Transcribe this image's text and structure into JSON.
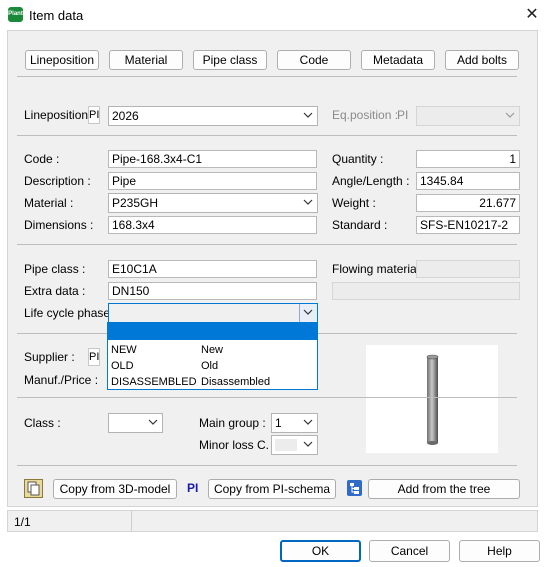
{
  "window": {
    "title": "Item data",
    "app_icon_text": "Plant"
  },
  "tabs": [
    "Lineposition",
    "Material",
    "Pipe class",
    "Code",
    "Metadata",
    "Add bolts"
  ],
  "lineposition": {
    "label": "Lineposition :",
    "pi": "PI",
    "value": "2026",
    "eq_label": "Eq.position :",
    "eq_pi": "PI",
    "eq_value": ""
  },
  "left_fields": {
    "code_label": "Code :",
    "code": "Pipe-168.3x4-C1",
    "description_label": "Description :",
    "description": "Pipe",
    "material_label": "Material :",
    "material": "P235GH",
    "dimensions_label": "Dimensions :",
    "dimensions": "168.3x4"
  },
  "right_fields": {
    "quantity_label": "Quantity :",
    "quantity": "1",
    "angle_label": "Angle/Length :",
    "angle": "1345.84",
    "weight_label": "Weight :",
    "weight": "21.677",
    "standard_label": "Standard :",
    "standard": "SFS-EN10217-2"
  },
  "pipe": {
    "pipe_class_label": "Pipe class :",
    "pipe_class": "E10C1A",
    "extra_label": "Extra data :",
    "extra": "DN150",
    "lifecycle_label": "Life cycle phase:",
    "lifecycle": "",
    "flowing_label": "Flowing material :",
    "flowing": ""
  },
  "lifecycle_options": [
    {
      "code": "NEW",
      "name": "New"
    },
    {
      "code": "OLD",
      "name": "Old"
    },
    {
      "code": "DISASSEMBLED",
      "name": "Disassembled"
    }
  ],
  "supplier": {
    "supplier_label": "Supplier :",
    "pi": "PI",
    "manuf_label": "Manuf./Price :"
  },
  "class_section": {
    "class_label": "Class :",
    "class_value": "",
    "main_group_label": "Main group :",
    "main_group_value": "1",
    "minor_loss_label": "Minor loss C. :",
    "minor_loss_value": ""
  },
  "actions": {
    "copy_3d": "Copy from 3D-model",
    "pi_text": "PI",
    "copy_pi": "Copy from PI-schema",
    "add_tree": "Add from the tree"
  },
  "status": {
    "page": "1/1"
  },
  "footer": {
    "ok": "OK",
    "cancel": "Cancel",
    "help": "Help"
  },
  "colors": {
    "selection": "#0078d7",
    "pi_blue": "#1a1aa8",
    "accent": "#0067c0"
  }
}
